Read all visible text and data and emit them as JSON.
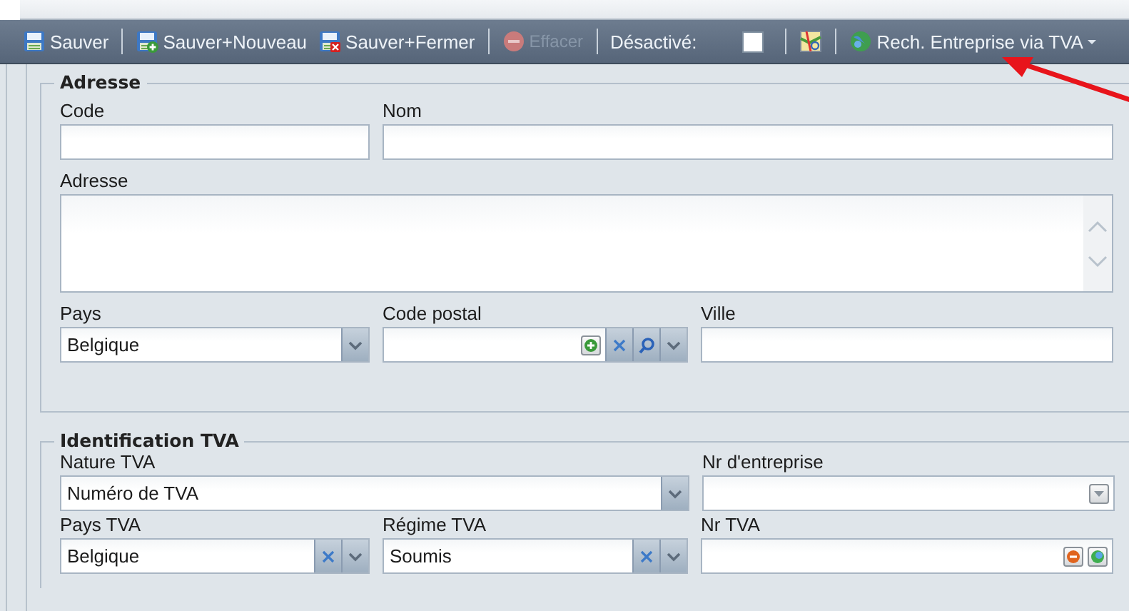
{
  "toolbar": {
    "items": [
      {
        "kind": "button",
        "label": "Sauver",
        "disabled": false
      },
      {
        "kind": "separator"
      },
      {
        "kind": "button",
        "label": "Sauver+Nouveau",
        "disabled": false
      },
      {
        "kind": "button",
        "label": "Sauver+Fermer",
        "disabled": false
      },
      {
        "kind": "separator"
      },
      {
        "kind": "button",
        "label": "Effacer",
        "disabled": true
      },
      {
        "kind": "separator"
      },
      {
        "kind": "checkbox",
        "label": "Désactivé:",
        "checked": false
      },
      {
        "kind": "separator"
      },
      {
        "kind": "icon_button"
      },
      {
        "kind": "separator"
      },
      {
        "kind": "menu_button",
        "label": "Rech. Entreprise via TVA"
      }
    ]
  },
  "sections": [
    {
      "legend": "Adresse",
      "rows": [
        [
          {
            "label": "Code",
            "kind": "text"
          },
          {
            "label": "Nom",
            "kind": "text"
          }
        ],
        [
          {
            "label": "Adresse",
            "kind": "textarea"
          }
        ],
        [
          {
            "label": "Pays",
            "kind": "combo",
            "value": "Belgique"
          },
          {
            "label": "Code postal",
            "kind": "lookup"
          },
          {
            "label": "Ville",
            "kind": "text"
          }
        ]
      ]
    },
    {
      "legend": "Identification TVA",
      "rows": [
        [
          {
            "label": "Nature TVA",
            "kind": "combo",
            "value": "Numéro de TVA"
          },
          "",
          {
            "label": "Nr d'entreprise",
            "kind": "picker"
          }
        ],
        [
          {
            "label": "Pays TVA",
            "kind": "combo_clear",
            "value": "Belgique"
          },
          {
            "label": "Régime TVA",
            "kind": "combo_clear",
            "value": "Soumis"
          },
          {
            "label": "Nr TVA",
            "kind": "vat"
          }
        ]
      ]
    }
  ]
}
